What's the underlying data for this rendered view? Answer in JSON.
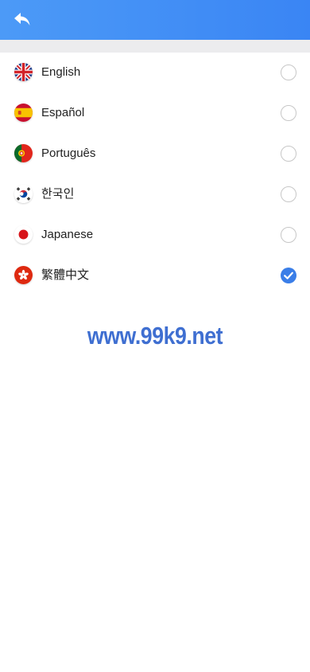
{
  "header": {
    "back_icon": "undo-arrow-icon",
    "background": "#3a85f4"
  },
  "languages": [
    {
      "label": "English",
      "flag": "uk-flag-icon",
      "selected": false
    },
    {
      "label": "Español",
      "flag": "spain-flag-icon",
      "selected": false
    },
    {
      "label": "Português",
      "flag": "portugal-flag-icon",
      "selected": false
    },
    {
      "label": "한국인",
      "flag": "korea-flag-icon",
      "selected": false
    },
    {
      "label": "Japanese",
      "flag": "japan-flag-icon",
      "selected": false
    },
    {
      "label": "繁體中文",
      "flag": "hong-kong-flag-icon",
      "selected": true
    }
  ],
  "watermark": "www.99k9.net",
  "colors": {
    "accent": "#3a7ee8",
    "watermark": "#3f6fd1"
  }
}
